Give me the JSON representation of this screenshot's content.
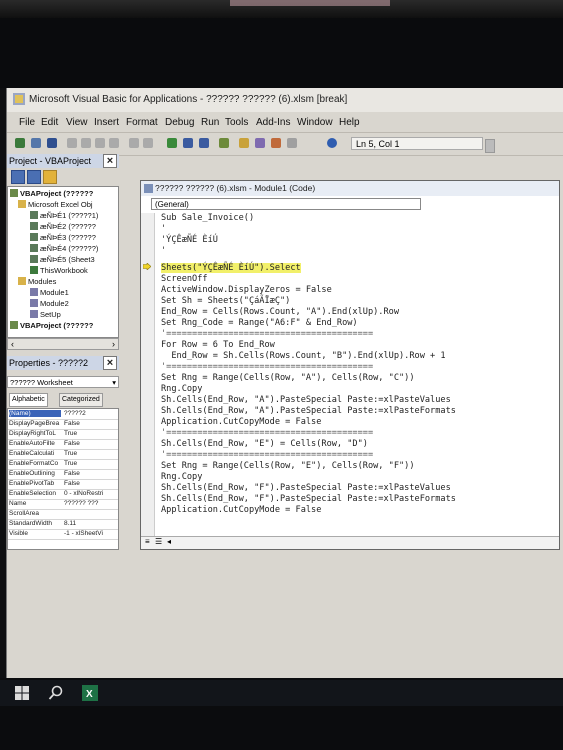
{
  "window": {
    "title": "Microsoft Visual Basic for Applications - ?????? ?????? (6).xlsm [break]"
  },
  "menu": [
    "File",
    "Edit",
    "View",
    "Insert",
    "Format",
    "Debug",
    "Run",
    "Tools",
    "Add-Ins",
    "Window",
    "Help"
  ],
  "toolbar": {
    "position": "Ln 5, Col 1"
  },
  "project": {
    "title": "Project - VBAProject",
    "tree": [
      {
        "label": "VBAProject (??????",
        "icon": "vba-project-icon"
      },
      {
        "label": "Microsoft Excel Obj",
        "icon": "folder-icon"
      },
      {
        "label": "æÑÞÉ1 (?????1)",
        "icon": "sheet-icon"
      },
      {
        "label": "æÑÞÉ2 (??????",
        "icon": "sheet-icon"
      },
      {
        "label": "æÑÞÉ3 (??????",
        "icon": "sheet-icon"
      },
      {
        "label": "æÑÞÉ4 (??????)",
        "icon": "sheet-icon"
      },
      {
        "label": "æÑÞÉ5 (Sheet3",
        "icon": "sheet-icon"
      },
      {
        "label": "ThisWorkbook",
        "icon": "workbook-icon"
      },
      {
        "label": "Modules",
        "icon": "folder-icon"
      },
      {
        "label": "Module1",
        "icon": "module-icon"
      },
      {
        "label": "Module2",
        "icon": "module-icon"
      },
      {
        "label": "SetUp",
        "icon": "module-icon"
      },
      {
        "label": "VBAProject (??????",
        "icon": "vba-project-icon"
      }
    ]
  },
  "properties": {
    "title": "Properties - ?????2",
    "combo": "?????? Worksheet",
    "tabs": [
      "Alphabetic",
      "Categorized"
    ],
    "rows": [
      {
        "name": "(Name)",
        "value": "?????2"
      },
      {
        "name": "DisplayPageBrea",
        "value": "False"
      },
      {
        "name": "DisplayRightToL",
        "value": "True"
      },
      {
        "name": "EnableAutoFilte",
        "value": "False"
      },
      {
        "name": "EnableCalculati",
        "value": "True"
      },
      {
        "name": "EnableFormatCo",
        "value": "True"
      },
      {
        "name": "EnableOutlining",
        "value": "False"
      },
      {
        "name": "EnablePivotTab",
        "value": "False"
      },
      {
        "name": "EnableSelection",
        "value": "0 - xlNoRestri"
      },
      {
        "name": "Name",
        "value": "?????? ???"
      },
      {
        "name": "ScrollArea",
        "value": ""
      },
      {
        "name": "StandardWidth",
        "value": "8.11"
      },
      {
        "name": "Visible",
        "value": "-1 - xlSheetVi"
      }
    ]
  },
  "code_window": {
    "title": "?????? ?????? (6).xlsm - Module1 (Code)",
    "object_combo": "(General)",
    "lines": [
      "Sub Sale_Invoice()",
      "'",
      "'ÝÇÊæÑÉ ÈíÚ",
      "'",
      "Sheets(\"ÝÇÊæÑÉ ÈíÚ\").Select",
      "ScreenOff",
      "ActiveWindow.DisplayZeros = False",
      "Set Sh = Sheets(\"ÇáÃÏæÇ\")",
      "End_Row = Cells(Rows.Count, \"A\").End(xlUp).Row",
      "Set Rng_Code = Range(\"A6:F\" & End_Row)",
      "'========================================",
      "For Row = 6 To End_Row",
      "  End_Row = Sh.Cells(Rows.Count, \"B\").End(xlUp).Row + 1",
      "'========================================",
      "Set Rng = Range(Cells(Row, \"A\"), Cells(Row, \"C\"))",
      "Rng.Copy",
      "Sh.Cells(End_Row, \"A\").PasteSpecial Paste:=xlPasteValues",
      "Sh.Cells(End_Row, \"A\").PasteSpecial Paste:=xlPasteFormats",
      "Application.CutCopyMode = False",
      "'========================================",
      "Sh.Cells(End_Row, \"E\") = Cells(Row, \"D\")",
      "'========================================",
      "Set Rng = Range(Cells(Row, \"E\"), Cells(Row, \"F\"))",
      "Rng.Copy",
      "Sh.Cells(End_Row, \"F\").PasteSpecial Paste:=xlPasteValues",
      "Sh.Cells(End_Row, \"F\").PasteSpecial Paste:=xlPasteFormats",
      "Application.CutCopyMode = False"
    ]
  },
  "taskbar": {
    "items": [
      "windows-start-icon",
      "search-icon",
      "excel-icon"
    ]
  }
}
